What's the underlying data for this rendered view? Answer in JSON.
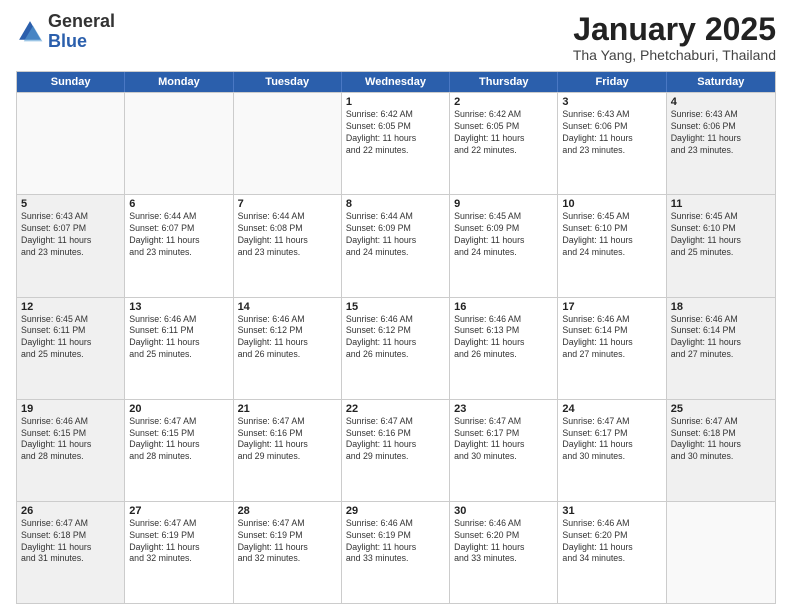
{
  "logo": {
    "general": "General",
    "blue": "Blue"
  },
  "header": {
    "title": "January 2025",
    "subtitle": "Tha Yang, Phetchaburi, Thailand"
  },
  "weekdays": [
    "Sunday",
    "Monday",
    "Tuesday",
    "Wednesday",
    "Thursday",
    "Friday",
    "Saturday"
  ],
  "weeks": [
    [
      {
        "day": "",
        "info": ""
      },
      {
        "day": "",
        "info": ""
      },
      {
        "day": "",
        "info": ""
      },
      {
        "day": "1",
        "info": "Sunrise: 6:42 AM\nSunset: 6:05 PM\nDaylight: 11 hours\nand 22 minutes."
      },
      {
        "day": "2",
        "info": "Sunrise: 6:42 AM\nSunset: 6:05 PM\nDaylight: 11 hours\nand 22 minutes."
      },
      {
        "day": "3",
        "info": "Sunrise: 6:43 AM\nSunset: 6:06 PM\nDaylight: 11 hours\nand 23 minutes."
      },
      {
        "day": "4",
        "info": "Sunrise: 6:43 AM\nSunset: 6:06 PM\nDaylight: 11 hours\nand 23 minutes."
      }
    ],
    [
      {
        "day": "5",
        "info": "Sunrise: 6:43 AM\nSunset: 6:07 PM\nDaylight: 11 hours\nand 23 minutes."
      },
      {
        "day": "6",
        "info": "Sunrise: 6:44 AM\nSunset: 6:07 PM\nDaylight: 11 hours\nand 23 minutes."
      },
      {
        "day": "7",
        "info": "Sunrise: 6:44 AM\nSunset: 6:08 PM\nDaylight: 11 hours\nand 23 minutes."
      },
      {
        "day": "8",
        "info": "Sunrise: 6:44 AM\nSunset: 6:09 PM\nDaylight: 11 hours\nand 24 minutes."
      },
      {
        "day": "9",
        "info": "Sunrise: 6:45 AM\nSunset: 6:09 PM\nDaylight: 11 hours\nand 24 minutes."
      },
      {
        "day": "10",
        "info": "Sunrise: 6:45 AM\nSunset: 6:10 PM\nDaylight: 11 hours\nand 24 minutes."
      },
      {
        "day": "11",
        "info": "Sunrise: 6:45 AM\nSunset: 6:10 PM\nDaylight: 11 hours\nand 25 minutes."
      }
    ],
    [
      {
        "day": "12",
        "info": "Sunrise: 6:45 AM\nSunset: 6:11 PM\nDaylight: 11 hours\nand 25 minutes."
      },
      {
        "day": "13",
        "info": "Sunrise: 6:46 AM\nSunset: 6:11 PM\nDaylight: 11 hours\nand 25 minutes."
      },
      {
        "day": "14",
        "info": "Sunrise: 6:46 AM\nSunset: 6:12 PM\nDaylight: 11 hours\nand 26 minutes."
      },
      {
        "day": "15",
        "info": "Sunrise: 6:46 AM\nSunset: 6:12 PM\nDaylight: 11 hours\nand 26 minutes."
      },
      {
        "day": "16",
        "info": "Sunrise: 6:46 AM\nSunset: 6:13 PM\nDaylight: 11 hours\nand 26 minutes."
      },
      {
        "day": "17",
        "info": "Sunrise: 6:46 AM\nSunset: 6:14 PM\nDaylight: 11 hours\nand 27 minutes."
      },
      {
        "day": "18",
        "info": "Sunrise: 6:46 AM\nSunset: 6:14 PM\nDaylight: 11 hours\nand 27 minutes."
      }
    ],
    [
      {
        "day": "19",
        "info": "Sunrise: 6:46 AM\nSunset: 6:15 PM\nDaylight: 11 hours\nand 28 minutes."
      },
      {
        "day": "20",
        "info": "Sunrise: 6:47 AM\nSunset: 6:15 PM\nDaylight: 11 hours\nand 28 minutes."
      },
      {
        "day": "21",
        "info": "Sunrise: 6:47 AM\nSunset: 6:16 PM\nDaylight: 11 hours\nand 29 minutes."
      },
      {
        "day": "22",
        "info": "Sunrise: 6:47 AM\nSunset: 6:16 PM\nDaylight: 11 hours\nand 29 minutes."
      },
      {
        "day": "23",
        "info": "Sunrise: 6:47 AM\nSunset: 6:17 PM\nDaylight: 11 hours\nand 30 minutes."
      },
      {
        "day": "24",
        "info": "Sunrise: 6:47 AM\nSunset: 6:17 PM\nDaylight: 11 hours\nand 30 minutes."
      },
      {
        "day": "25",
        "info": "Sunrise: 6:47 AM\nSunset: 6:18 PM\nDaylight: 11 hours\nand 30 minutes."
      }
    ],
    [
      {
        "day": "26",
        "info": "Sunrise: 6:47 AM\nSunset: 6:18 PM\nDaylight: 11 hours\nand 31 minutes."
      },
      {
        "day": "27",
        "info": "Sunrise: 6:47 AM\nSunset: 6:19 PM\nDaylight: 11 hours\nand 32 minutes."
      },
      {
        "day": "28",
        "info": "Sunrise: 6:47 AM\nSunset: 6:19 PM\nDaylight: 11 hours\nand 32 minutes."
      },
      {
        "day": "29",
        "info": "Sunrise: 6:46 AM\nSunset: 6:19 PM\nDaylight: 11 hours\nand 33 minutes."
      },
      {
        "day": "30",
        "info": "Sunrise: 6:46 AM\nSunset: 6:20 PM\nDaylight: 11 hours\nand 33 minutes."
      },
      {
        "day": "31",
        "info": "Sunrise: 6:46 AM\nSunset: 6:20 PM\nDaylight: 11 hours\nand 34 minutes."
      },
      {
        "day": "",
        "info": ""
      }
    ]
  ]
}
